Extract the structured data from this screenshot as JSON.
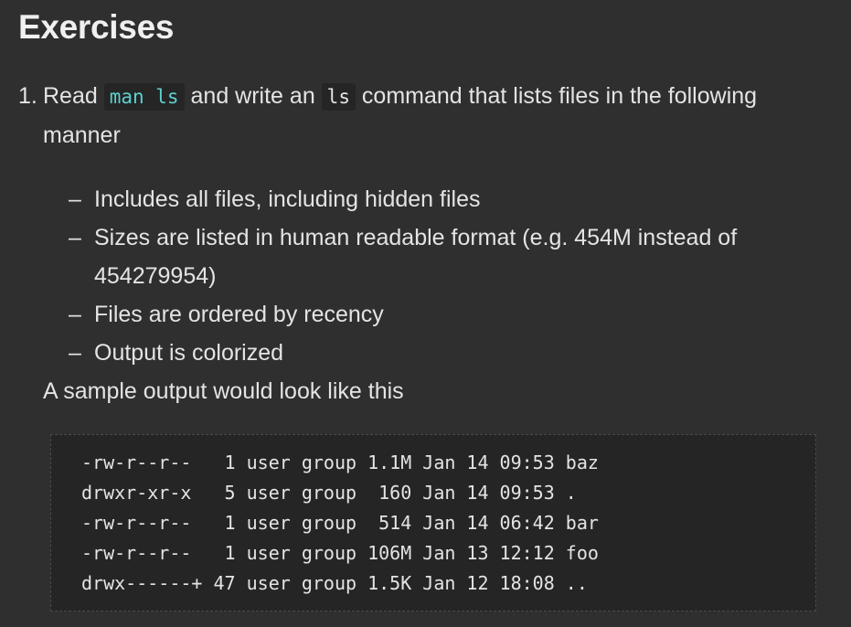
{
  "heading": "Exercises",
  "exercise": {
    "number": "1.",
    "text_before": "Read ",
    "code_man": "man ls",
    "text_middle": " and write an ",
    "code_ls": "ls",
    "text_after": " command that lists files in the following manner",
    "bullets": [
      "Includes all files, including hidden files",
      "Sizes are listed in human readable format (e.g. 454M instead of 454279954)",
      "Files are ordered by recency",
      "Output is colorized"
    ],
    "sample_intro": "A sample output would look like this"
  },
  "sample_output": [
    "-rw-r--r--   1 user group 1.1M Jan 14 09:53 baz",
    "drwxr-xr-x   5 user group  160 Jan 14 09:53 .",
    "-rw-r--r--   1 user group  514 Jan 14 06:42 bar",
    "-rw-r--r--   1 user group 106M Jan 13 12:12 foo",
    "drwx------+ 47 user group 1.5K Jan 12 18:08 .."
  ],
  "colors": {
    "background": "#2f2f2f",
    "code_background": "#252525",
    "text": "#e4e4e4",
    "inline_code_accent": "#5fd0d0"
  }
}
